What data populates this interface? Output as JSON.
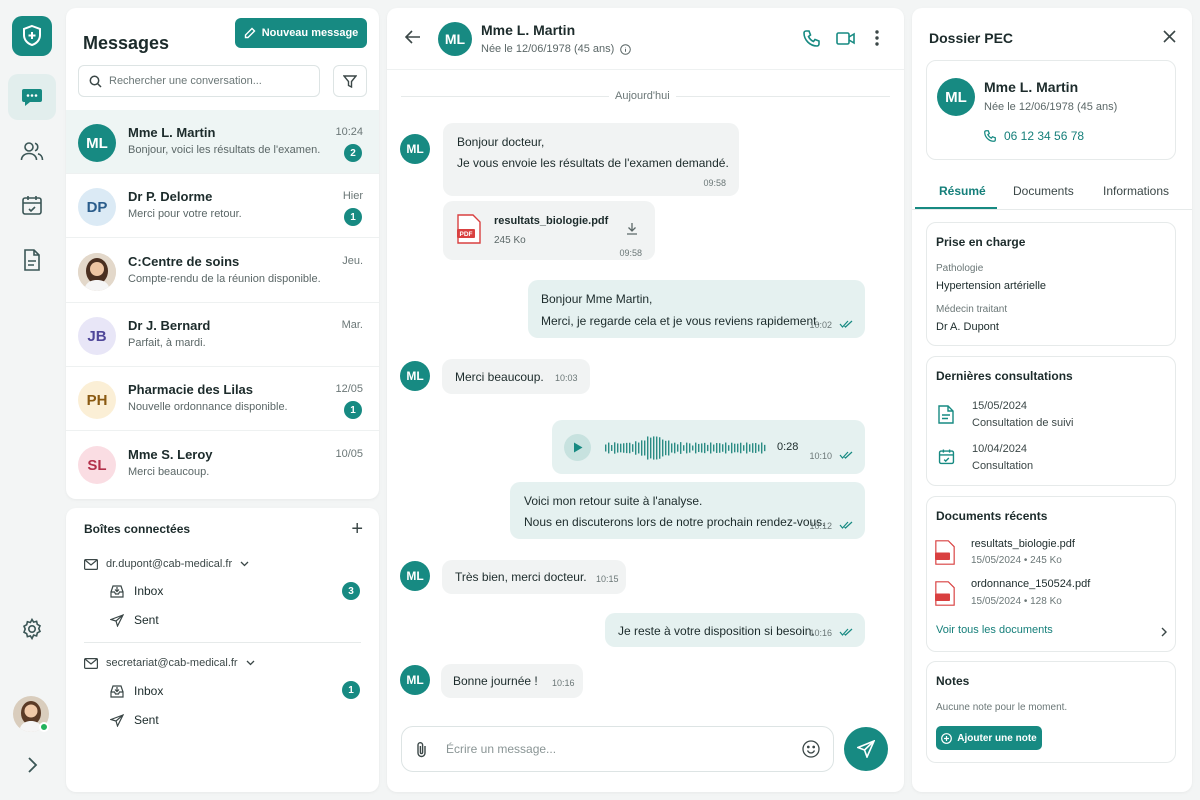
{
  "nav": {
    "items": [
      {
        "icon": "chat-icon",
        "active": true
      },
      {
        "icon": "users-icon"
      },
      {
        "icon": "calendar-icon"
      },
      {
        "icon": "document-icon"
      }
    ],
    "settings_icon": "gear-icon",
    "expand_icon": "chevron-right-icon"
  },
  "messages": {
    "title": "Messages",
    "new_button": "Nouveau message",
    "search_placeholder": "Rechercher une conversation...",
    "conversations": [
      {
        "initials": "ML",
        "name": "Mme L. Martin",
        "preview": "Bonjour, voici les résultats de l'examen.",
        "time": "10:24",
        "badge": "2",
        "selected": true,
        "avatar_bg": "#178a82",
        "avatar_fg": "#ffffff"
      },
      {
        "initials": "DP",
        "name": "Dr P. Delorme",
        "preview": "Merci pour votre retour.",
        "time": "Hier",
        "badge": "1",
        "avatar_bg": "#dbeaf5",
        "avatar_fg": "#2a5d8c"
      },
      {
        "initials": "",
        "name": "C:Centre de soins",
        "preview": "Compte-rendu de la réunion disponible.",
        "time": "Jeu.",
        "badge": "",
        "photo": true
      },
      {
        "initials": "JB",
        "name": "Dr J. Bernard",
        "preview": "Parfait, à mardi.",
        "time": "Mar.",
        "badge": "",
        "avatar_bg": "#e8e6f7",
        "avatar_fg": "#4f4799"
      },
      {
        "initials": "PH",
        "name": "Pharmacie des Lilas",
        "preview": "Nouvelle ordonnance disponible.",
        "time": "12/05",
        "badge": "1",
        "avatar_bg": "#fbefd6",
        "avatar_fg": "#8a5a12"
      },
      {
        "initials": "SL",
        "name": "Mme S. Leroy",
        "preview": "Merci beaucoup.",
        "time": "10/05",
        "badge": "",
        "avatar_bg": "#fadde3",
        "avatar_fg": "#b2304a"
      }
    ]
  },
  "boxes": {
    "title": "Boîtes connectées",
    "accounts": [
      {
        "email": "dr.dupont@cab-medical.fr",
        "inbox": "Inbox",
        "inbox_count": "3",
        "sent": "Sent"
      },
      {
        "email": "secretariat@cab-medical.fr",
        "inbox": "Inbox",
        "inbox_count": "1",
        "sent": "Sent"
      }
    ]
  },
  "chat": {
    "initials": "ML",
    "name": "Mme L. Martin",
    "dob": "Née le 12/06/1978 (45 ans)",
    "day_label": "Aujourd'hui",
    "messages": {
      "m1_line1": "Bonjour docteur,",
      "m1_line2": "Je vous envoie les résultats de l'examen demandé.",
      "m1_time": "09:58",
      "file_name": "resultats_biologie.pdf",
      "file_size": "245 Ko",
      "file_time": "09:58",
      "file_badge": "PDF",
      "m2_line1": "Bonjour Mme Martin,",
      "m2_line2": "Merci, je regarde cela et je vous reviens rapidement.",
      "m2_time": "10:02",
      "m3": "Merci beaucoup.",
      "m3_time": "10:03",
      "audio_duration": "0:28",
      "audio_time": "10:10",
      "m4_line1": "Voici mon retour suite à l'analyse.",
      "m4_line2": "Nous en discuterons lors de notre prochain rendez-vous.",
      "m4_time": "10:12",
      "m5": "Très bien, merci docteur.",
      "m5_time": "10:15",
      "m6": "Je reste à votre disposition si besoin.",
      "m6_time": "10:16",
      "m7": "Bonne journée !",
      "m7_time": "10:16"
    },
    "composer_placeholder": "Écrire un message..."
  },
  "dossier": {
    "title": "Dossier PEC",
    "patient_initials": "ML",
    "patient_name": "Mme L. Martin",
    "patient_dob": "Née le 12/06/1978 (45 ans)",
    "patient_phone": "06 12 34 56 78",
    "tabs": [
      "Résumé",
      "Documents",
      "Informations"
    ],
    "prise_en_charge": {
      "title": "Prise en charge",
      "pathologie_label": "Pathologie",
      "pathologie": "Hypertension artérielle",
      "medecin_label": "Médecin traitant",
      "medecin": "Dr A. Dupont"
    },
    "consultations": {
      "title": "Dernières consultations",
      "items": [
        {
          "date": "15/05/2024",
          "type": "Consultation de suivi"
        },
        {
          "date": "10/04/2024",
          "type": "Consultation"
        }
      ]
    },
    "documents": {
      "title": "Documents récents",
      "items": [
        {
          "name": "resultats_biologie.pdf",
          "meta": "15/05/2024 • 245 Ko"
        },
        {
          "name": "ordonnance_150524.pdf",
          "meta": "15/05/2024 • 128 Ko"
        }
      ],
      "see_all": "Voir tous les documents"
    },
    "notes": {
      "title": "Notes",
      "empty": "Aucune note pour le moment.",
      "add": "Ajouter une note"
    }
  },
  "colors": {
    "accent": "#178a82",
    "accent_light": "#e5f1f0",
    "bubble_in": "#f1f3f3"
  }
}
